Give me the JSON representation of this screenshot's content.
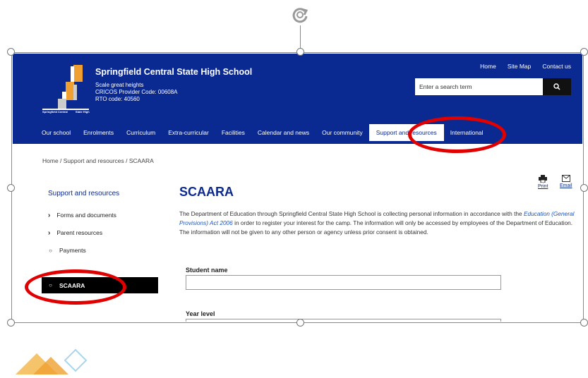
{
  "header": {
    "school_name": "Springfield Central State High School",
    "tagline": [
      "Scale great heights",
      "CRICOS Provider Code: 00608A",
      "RTO code: 40560"
    ],
    "logo_lines": [
      "Springfield Central",
      "State High"
    ],
    "top_links": [
      "Home",
      "Site Map",
      "Contact us"
    ],
    "search_placeholder": "Enter a search term"
  },
  "nav": {
    "items": [
      "Our school",
      "Enrolments",
      "Curriculum",
      "Extra-curricular",
      "Facilities",
      "Calendar and news",
      "Our community",
      "Support and resources",
      "International"
    ],
    "active_index": 7
  },
  "breadcrumb": "Home  /  Support and resources  /  SCAARA",
  "sidebar": {
    "title": "Support and resources",
    "items": [
      {
        "label": "Forms and documents",
        "marker": "chevron"
      },
      {
        "label": "Parent resources",
        "marker": "chevron"
      },
      {
        "label": "Payments",
        "marker": "circle"
      },
      {
        "label": "SCAARA",
        "marker": "circle",
        "active": true
      }
    ]
  },
  "main": {
    "title": "SCAARA",
    "print_label": "Print",
    "email_label": "Email",
    "intro_before": "The Department of Education through Springfield Central State High School is collecting personal information in accordance with the ",
    "intro_link": "Education (General Provisions) Act 2006",
    "intro_after": " in order to register your interest for the camp. The information will only be accessed by employees of the Department of Education. The information will not be given to any other person or agency unless prior consent is obtained.",
    "fields": [
      {
        "label": "Student name",
        "value": ""
      },
      {
        "label": "Year level",
        "value": ""
      }
    ]
  },
  "colors": {
    "header_bg": "#0a2991",
    "annotation": "#e00000",
    "logo_accent": "#f0a030"
  },
  "icons": [
    "rotate-icon",
    "search-icon",
    "print-icon",
    "email-icon",
    "chevron-right-icon",
    "circle-bullet-icon"
  ]
}
